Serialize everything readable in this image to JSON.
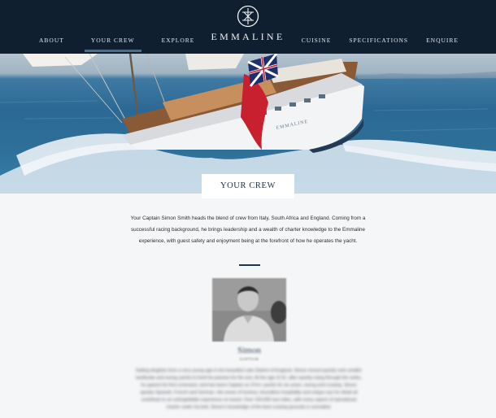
{
  "nav": {
    "left": [
      {
        "label": "ABOUT",
        "active": false
      },
      {
        "label": "YOUR CREW",
        "active": true
      },
      {
        "label": "EXPLORE",
        "active": false
      }
    ],
    "right": [
      {
        "label": "CUISINE",
        "active": false
      },
      {
        "label": "SPECIFICATIONS",
        "active": false
      },
      {
        "label": "ENQUIRE",
        "active": false
      }
    ]
  },
  "brand": {
    "name": "EMMALINE",
    "logo_icon": "emmaline-monogram-icon"
  },
  "hero": {
    "image": "sailing-yacht-with-red-ensign-flag",
    "hull_lettering": "EMMALINE"
  },
  "section": {
    "title": "YOUR CREW"
  },
  "intro_text": "Your Captain Simon Smith heads the blend of crew from Italy, South Africa and England. Coming from a successful racing background, he brings leadership and a wealth of charter knowledge to the Emmaline experience, with guest safety and enjoyment being at the forefront of how he operates the yacht.",
  "crew": [
    {
      "name": "Simon",
      "role": "CAPTAIN",
      "photo": "captain-portrait",
      "bio": "Sailing dinghies from a very young age in the beautiful Lake District of England, Simon moved quickly onto smaller keelboats and racing yachts to feed his passion for the sea. At the age of 22, after quickly rising through the ranks, he gained his first command, and has been Captain on 37m+ yachts for six years, racing and cruising. Simon speaks Spanish, French and German. His sense of humour, boundless hospitality and unique eye for detail all contribute to an unforgettable experience on board. Over 150,000 sea miles, with every aspect of operational charter under his belt, Simon's knowledge of the best cruising grounds is unrivalled."
    }
  ],
  "colors": {
    "header_bg": "#0f1f30",
    "active_underline": "#4e6d88",
    "divider": "#1d3550",
    "page_bg": "#f5f6f8",
    "flag_red": "#c8202f",
    "flag_blue": "#1f2f6e"
  }
}
